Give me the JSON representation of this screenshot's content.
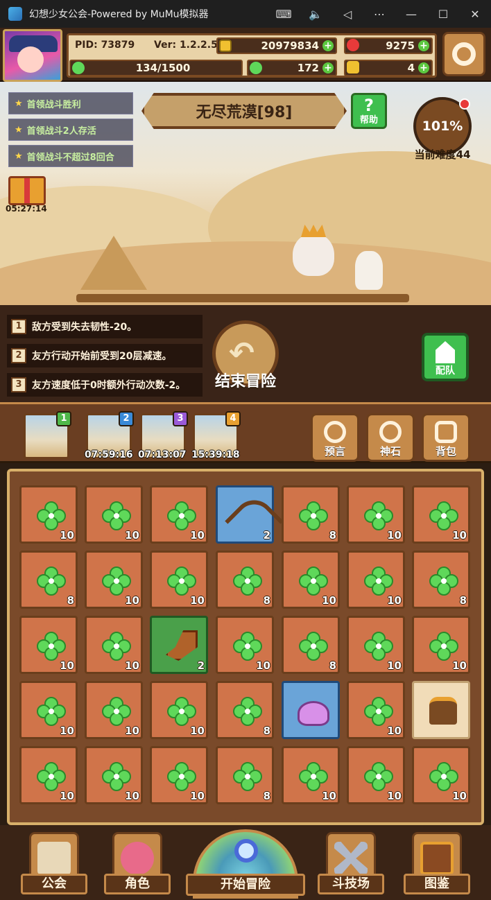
{
  "window": {
    "title": "幻想少女公会-Powered by MuMu模拟器",
    "controls": [
      "keyboard-icon",
      "volume-icon",
      "back-icon",
      "more-icon",
      "minimize-icon",
      "maximize-icon",
      "close-icon"
    ]
  },
  "hud": {
    "pid": "PID: 73879",
    "version": "Ver: 1.2.2.5",
    "gold": "20979834",
    "gems": "9275",
    "energy": "134/1500",
    "clover": "172",
    "keys": "4"
  },
  "stage": {
    "quests": [
      "首领战斗胜利",
      "首领战斗2人存活",
      "首领战斗不超过8回合"
    ],
    "name": "无尽荒漠[98]",
    "help_label": "帮助",
    "help_glyph": "?",
    "difficulty_percent": "101%",
    "difficulty_label": "当前难度44",
    "gift_timer": "05:27:14"
  },
  "buffs": [
    {
      "num": "1",
      "text": "敌方受到失去韧性-20。"
    },
    {
      "num": "2",
      "text": "友方行动开始前受到20层减速。"
    },
    {
      "num": "3",
      "text": "友方速度低于0时额外行动次数-2。"
    }
  ],
  "actions": {
    "end_adventure": "结束冒险",
    "team": "配队"
  },
  "slots": [
    {
      "badge": "1",
      "badge_color": "#4fb84a",
      "timer": ""
    },
    {
      "badge": "2",
      "badge_color": "#3a8ad8",
      "timer": "07:59:16"
    },
    {
      "badge": "3",
      "badge_color": "#9a5ad8",
      "timer": "07:13:07"
    },
    {
      "badge": "4",
      "badge_color": "#e8a030",
      "timer": "15:39:18"
    }
  ],
  "tools": [
    "预言",
    "神石",
    "背包"
  ],
  "inventory": [
    [
      "10",
      "10",
      "10",
      "2",
      "8",
      "10",
      "10"
    ],
    [
      "8",
      "10",
      "10",
      "8",
      "10",
      "10",
      "8"
    ],
    [
      "10",
      "10",
      "2",
      "10",
      "8",
      "10",
      "10"
    ],
    [
      "10",
      "10",
      "10",
      "8",
      "",
      "10",
      ""
    ],
    [
      "10",
      "10",
      "10",
      "8",
      "10",
      "10",
      "10"
    ]
  ],
  "inventory_special": {
    "0-3": "bow",
    "2-2": "boot",
    "3-4": "slime",
    "3-6": "stump"
  },
  "nav": {
    "guild": "公会",
    "character": "角色",
    "start": "开始冒险",
    "arena": "斗技场",
    "codex": "图鉴"
  },
  "colors": {
    "accent_gold": "#c58a4a",
    "dark_brown": "#3a2416",
    "clover_green": "#5fd85a"
  }
}
